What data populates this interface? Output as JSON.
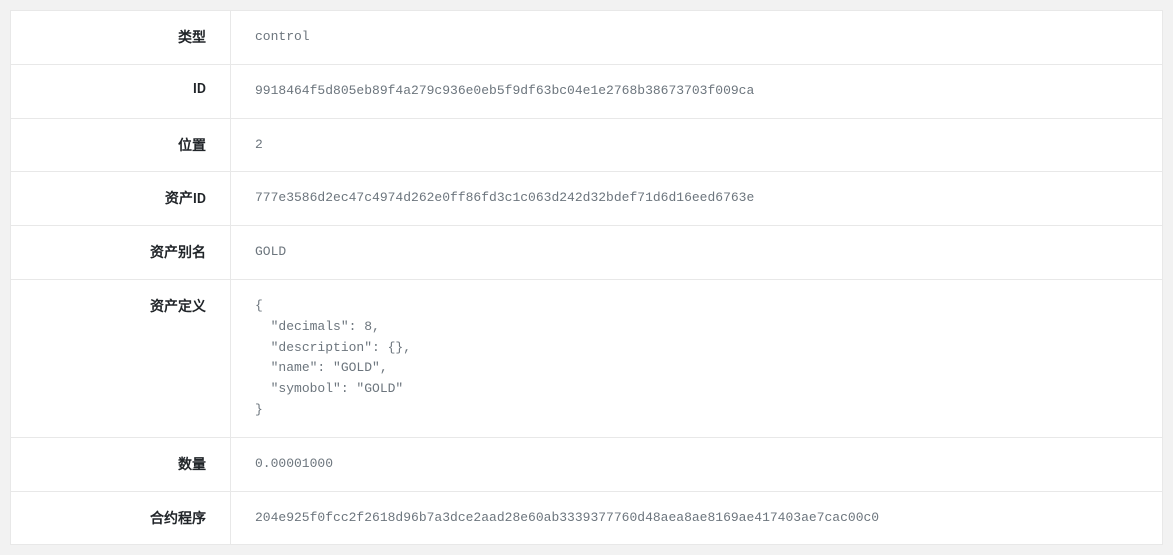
{
  "rows": [
    {
      "label": "类型",
      "value": "control"
    },
    {
      "label": "ID",
      "value": "9918464f5d805eb89f4a279c936e0eb5f9df63bc04e1e2768b38673703f009ca"
    },
    {
      "label": "位置",
      "value": "2"
    },
    {
      "label": "资产ID",
      "value": "777e3586d2ec47c4974d262e0ff86fd3c1c063d242d32bdef71d6d16eed6763e"
    },
    {
      "label": "资产别名",
      "value": "GOLD"
    },
    {
      "label": "资产定义",
      "value": "{\n  \"decimals\": 8,\n  \"description\": {},\n  \"name\": \"GOLD\",\n  \"symobol\": \"GOLD\"\n}"
    },
    {
      "label": "数量",
      "value": "0.00001000"
    },
    {
      "label": "合约程序",
      "value": "204e925f0fcc2f2618d96b7a3dce2aad28e60ab3339377760d48aea8ae8169ae417403ae7cac00c0"
    }
  ]
}
